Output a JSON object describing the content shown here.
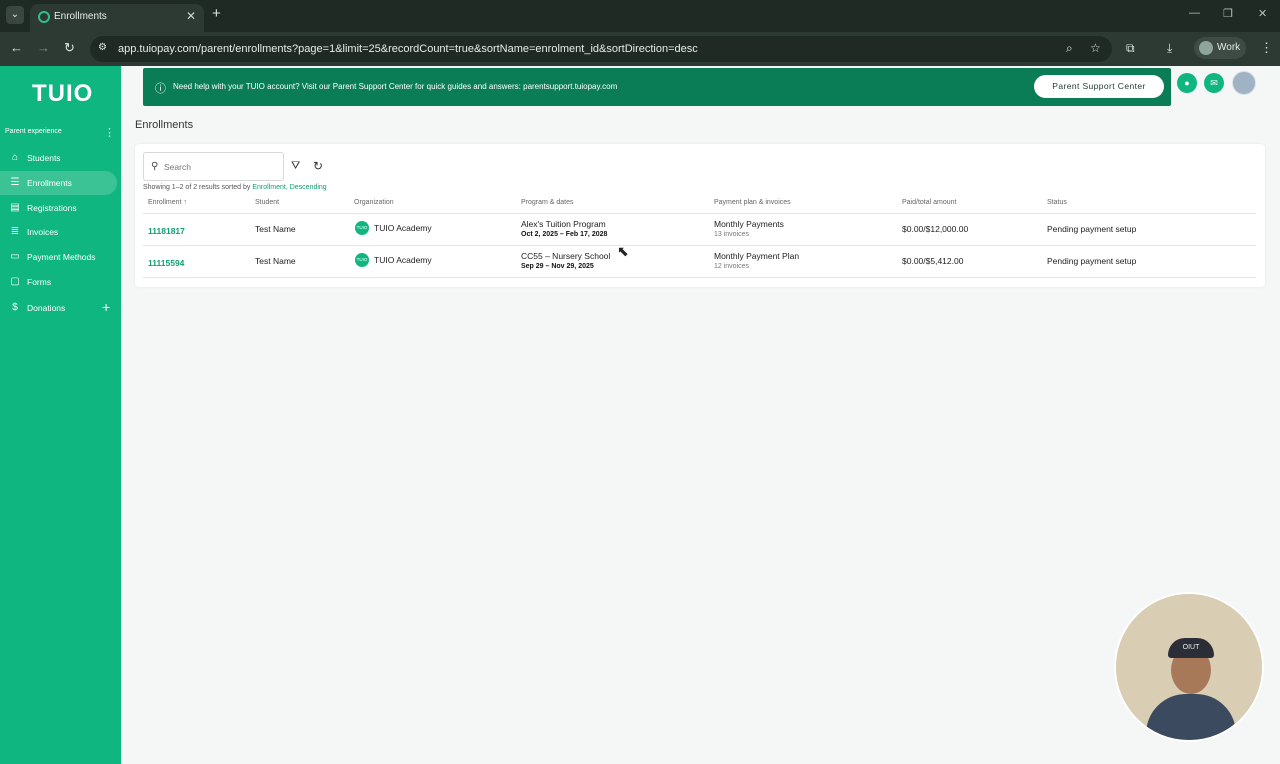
{
  "browser": {
    "tab_title": "Enrollments",
    "url": "app.tuiopay.com/parent/enrollments?page=1&limit=25&recordCount=true&sortName=enrolment_id&sortDirection=desc",
    "profile_name": "Work"
  },
  "sidebar": {
    "logo": "TUIO",
    "heading": "Parent experience",
    "items": [
      {
        "label": "Students",
        "icon": "graduation-cap-icon"
      },
      {
        "label": "Enrollments",
        "icon": "list-icon"
      },
      {
        "label": "Registrations",
        "icon": "document-icon"
      },
      {
        "label": "Invoices",
        "icon": "invoice-icon"
      },
      {
        "label": "Payment Methods",
        "icon": "credit-card-icon"
      },
      {
        "label": "Forms",
        "icon": "forms-icon"
      },
      {
        "label": "Donations",
        "icon": "dollar-icon"
      }
    ]
  },
  "banner": {
    "text": "Need help with your TUIO account? Visit our Parent Support Center for quick guides and answers: parentsupport.tuiopay.com",
    "button_label": "Parent Support Center"
  },
  "page": {
    "title": "Enrollments"
  },
  "search": {
    "placeholder": "Search"
  },
  "results": {
    "prefix": "Showing 1–2 of 2 results sorted by",
    "sort_field": "Enrollment",
    "sort_direction": "Descending"
  },
  "table": {
    "columns": [
      "Enrollment",
      "Student",
      "Organization",
      "Program & dates",
      "Payment plan & invoices",
      "Paid/total amount",
      "Status"
    ],
    "rows": [
      {
        "enrollment": "11181817",
        "student": "Test Name",
        "org_logo": "TUIO",
        "organization": "TUIO Academy",
        "program": "Alex's Tuition Program",
        "dates": "Oct 2, 2025 – Feb 17, 2028",
        "plan": "Monthly Payments",
        "invoices": "13 invoices",
        "amount": "$0.00/$12,000.00",
        "status": "Pending payment setup"
      },
      {
        "enrollment": "11115594",
        "student": "Test Name",
        "org_logo": "TUIO",
        "organization": "TUIO Academy",
        "program": "CC55 – Nursery School",
        "dates": "Sep 29 – Nov 29, 2025",
        "plan": "Monthly Payment Plan",
        "invoices": "12 invoices",
        "amount": "$0.00/$5,412.00",
        "status": "Pending payment setup"
      }
    ]
  },
  "webcam": {
    "cap_text": "OIUT"
  },
  "colors": {
    "brand_green": "#10b67f",
    "banner_green": "#0a7d57",
    "link_green": "#10a074"
  }
}
